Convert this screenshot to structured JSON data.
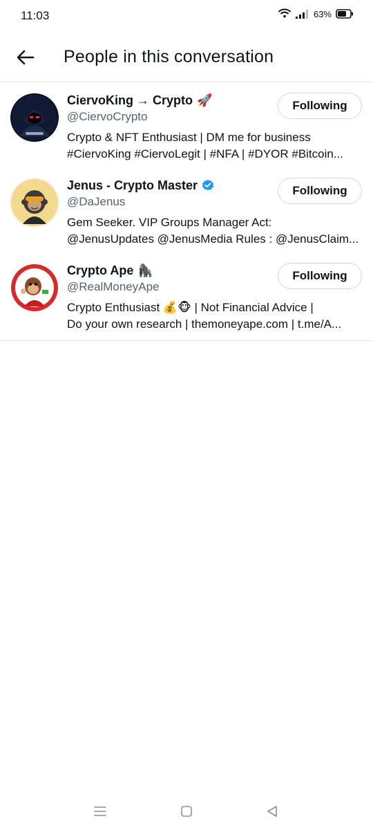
{
  "status": {
    "time": "11:03",
    "battery": "63%"
  },
  "header": {
    "title": "People in this conversation"
  },
  "people": [
    {
      "name": "CiervoKing → Crypto",
      "name_emoji": "🚀",
      "handle": "@CiervoCrypto",
      "bio_lines": [
        "Crypto & NFT Enthusiast | DM me for business",
        "#CiervoKing #CiervoLegit | #NFA | #DYOR #Bitcoin..."
      ],
      "button": "Following",
      "verified": false
    },
    {
      "name": "Jenus - Crypto Master",
      "name_emoji": "",
      "handle": "@DaJenus",
      "bio_lines": [
        "Gem Seeker. VIP Groups Manager  Act:",
        "@JenusUpdates @JenusMedia Rules : @JenusClaim..."
      ],
      "button": "Following",
      "verified": true
    },
    {
      "name": "Crypto Ape",
      "name_emoji": "🦍",
      "handle": "@RealMoneyApe",
      "bio_lines": [
        "Crypto Enthusiast 💰🐵 | Not Financial Advice |",
        "Do your own research | themoneyape.com | t.me/A..."
      ],
      "button": "Following",
      "verified": false
    }
  ],
  "colors": {
    "handle": "#536471",
    "verified": "#1d9bf0",
    "divider": "#e6e9eb"
  },
  "icons": {
    "back": "arrow-left-icon",
    "verified": "verified-badge-icon",
    "nav": [
      "recents-icon",
      "home-icon",
      "back-triangle-icon"
    ]
  }
}
